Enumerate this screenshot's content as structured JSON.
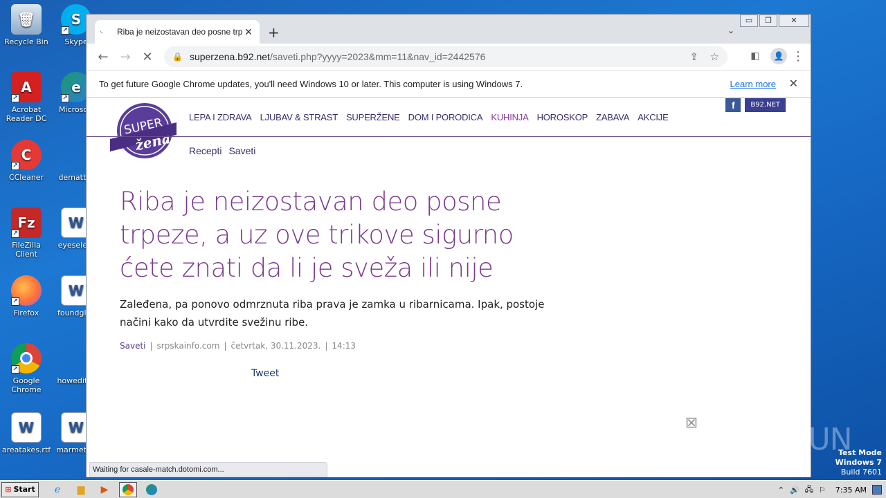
{
  "desktop": {
    "icons": [
      {
        "label": "Recycle Bin",
        "icon": "recycle-bin-icon",
        "color": "#9cb4d0"
      },
      {
        "label": "Skype",
        "icon": "skype-icon",
        "color": "#00aff0"
      },
      {
        "label": "Acrobat Reader DC",
        "icon": "acrobat-icon",
        "color": "#d4201e"
      },
      {
        "label": "Microsoft",
        "icon": "edge-icon",
        "color": "#1a9a6e"
      },
      {
        "label": "CCleaner",
        "icon": "ccleaner-icon",
        "color": "#e53935"
      },
      {
        "label": "dematter",
        "icon": "blank-doc-icon",
        "color": "#1c78d2"
      },
      {
        "label": "FileZilla Client",
        "icon": "filezilla-icon",
        "color": "#c62828"
      },
      {
        "label": "eyeselect",
        "icon": "word-doc-icon",
        "color": "#ffffff"
      },
      {
        "label": "Firefox",
        "icon": "firefox-icon",
        "color": "#ff7139"
      },
      {
        "label": "foundglas",
        "icon": "word-doc-icon",
        "color": "#ffffff"
      },
      {
        "label": "Google Chrome",
        "icon": "chrome-icon",
        "color": "#4285f4"
      },
      {
        "label": "howeditor",
        "icon": "blank-doc-icon",
        "color": "#1c78d2"
      },
      {
        "label": "areatakes.rtf",
        "icon": "word-doc-icon",
        "color": "#ffffff"
      },
      {
        "label": "marmetho",
        "icon": "word-doc-icon",
        "color": "#ffffff"
      }
    ]
  },
  "browser": {
    "tab_title": "Riba je neizostavan deo posne trpeze",
    "url_host": "superzena.b92.net",
    "url_path": "/saveti.php?yyyy=2023&mm=11&nav_id=2442576",
    "infobar_text": "To get future Google Chrome updates, you'll need Windows 10 or later. This computer is using Windows 7.",
    "infobar_link": "Learn more",
    "status_text": "Waiting for casale-match.dotomi.com..."
  },
  "site": {
    "logo_top": "SUPER",
    "logo_bottom": "žena",
    "nav": [
      "LEPA I ZDRAVA",
      "LJUBAV & STRAST",
      "SUPERŽENE",
      "DOM I PORODICA",
      "KUHINJA",
      "HOROSKOP",
      "ZABAVA",
      "AKCIJE"
    ],
    "active_nav": "KUHINJA",
    "subnav": [
      "Recepti",
      "Saveti"
    ],
    "social_fb": "f",
    "social_b92": "B92.NET"
  },
  "article": {
    "headline": "Riba je neizostavan deo posne trpeze, a uz ove trikove sigurno ćete znati da li je sveža ili nije",
    "lead": "Zaleđena, pa ponovo odmrznuta riba prava je zamka u ribarnicama. Ipak, postoje načini kako da utvrdite svežinu ribe.",
    "category": "Saveti",
    "source": "srpskainfo.com",
    "date": "četvrtak, 30.11.2023.",
    "time": "14:13",
    "tweet": "Tweet"
  },
  "watermark": {
    "text": "ANY RUN",
    "test_mode": "Test Mode",
    "os": "Windows 7",
    "build": "Build 7601"
  },
  "taskbar": {
    "start_label": "Start",
    "clock": "7:35 AM"
  },
  "colors": {
    "accent": "#7b3a8e",
    "nav": "#3d2d6e",
    "link": "#1a73e8"
  }
}
